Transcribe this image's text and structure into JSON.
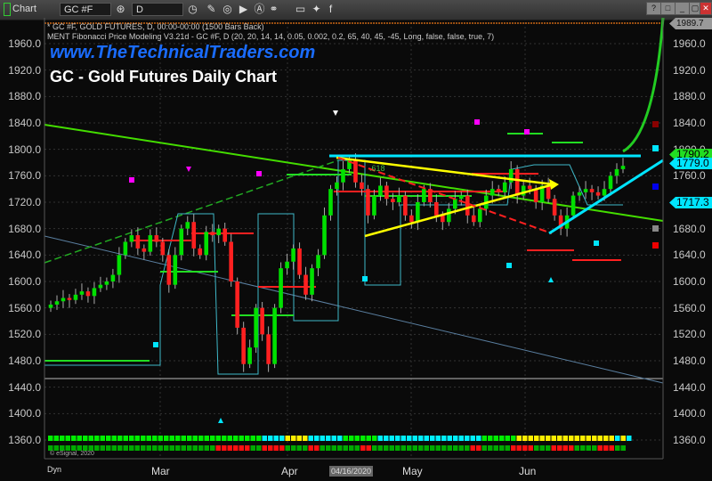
{
  "toolbar": {
    "app_label": "Chart",
    "symbol": "GC #F",
    "interval": "D",
    "window_buttons": [
      "?",
      "□",
      "_",
      "▢",
      "✕"
    ]
  },
  "header": {
    "line1": "* GC #F, GOLD FUTURES, D, 00:00-00:00 (1500 Bars Back)",
    "line2": "MENT Fibonacci Price Modeling V3.21d - GC #F, D (20, 20, 14, 14, 0.05, 0.002, 0.2, 65, 40, 45, -45, Long, false, false, true, 7)"
  },
  "brand": "www.TheTechnicalTraders.com",
  "copyright": "© eSignal, 2020",
  "dyn_label": "Dyn",
  "price_labels": {
    "top": "1989.7",
    "last": "1790.2",
    "level1": "1779.0",
    "level2": "1717.3"
  },
  "colors": {
    "up": "#00e000",
    "down": "#ff2020",
    "cyan": "#00e5ff",
    "yellow": "#ffff00",
    "lime": "#7cfc00",
    "magenta": "#ff00ff"
  },
  "annotation": ".618",
  "chart_data": {
    "type": "candlestick",
    "title": "GC - Gold Futures Daily Chart",
    "ylim": [
      1340,
      1990
    ],
    "yticks": [
      1360,
      1400,
      1440,
      1480,
      1520,
      1560,
      1600,
      1640,
      1680,
      1720,
      1760,
      1800,
      1840,
      1880,
      1920,
      1960
    ],
    "xticks": [
      "Mar",
      "Apr",
      "May",
      "Jun"
    ],
    "crosshair_date": "04/16/2020",
    "closes": [
      1565,
      1570,
      1575,
      1572,
      1580,
      1585,
      1578,
      1590,
      1595,
      1600,
      1610,
      1640,
      1660,
      1670,
      1650,
      1645,
      1670,
      1660,
      1640,
      1595,
      1640,
      1680,
      1690,
      1650,
      1640,
      1675,
      1670,
      1680,
      1660,
      1600,
      1530,
      1475,
      1500,
      1560,
      1520,
      1475,
      1560,
      1620,
      1630,
      1650,
      1610,
      1580,
      1620,
      1640,
      1700,
      1740,
      1750,
      1770,
      1785,
      1750,
      1740,
      1700,
      1730,
      1745,
      1725,
      1720,
      1730,
      1700,
      1690,
      1720,
      1740,
      1720,
      1700,
      1690,
      1710,
      1725,
      1730,
      1700,
      1690,
      1710,
      1730,
      1740,
      1735,
      1750,
      1770,
      1730,
      1745,
      1740,
      1720,
      1745,
      1725,
      1700,
      1680,
      1700,
      1730,
      1735,
      1740,
      1735,
      1730,
      1740,
      1760,
      1770,
      1775
    ],
    "signal_row1": [
      [
        "green",
        37
      ],
      [
        "cyan",
        4
      ],
      [
        "yellow",
        4
      ],
      [
        "cyan",
        6
      ],
      [
        "green",
        6
      ],
      [
        "cyan",
        18
      ],
      [
        "green",
        6
      ],
      [
        "yellow",
        17
      ],
      [
        "cyan",
        1
      ],
      [
        "yellow",
        1
      ],
      [
        "cyan",
        1
      ]
    ],
    "signal_row2": [
      [
        "green",
        29
      ],
      [
        "red",
        6
      ],
      [
        "green",
        2
      ],
      [
        "red",
        4
      ],
      [
        "green",
        4
      ],
      [
        "red",
        2
      ],
      [
        "green",
        7
      ],
      [
        "red",
        2
      ],
      [
        "green",
        17
      ],
      [
        "red",
        2
      ],
      [
        "green",
        5
      ],
      [
        "red",
        4
      ],
      [
        "green",
        3
      ],
      [
        "red",
        4
      ],
      [
        "green",
        4
      ],
      [
        "red",
        3
      ],
      [
        "green",
        2
      ]
    ]
  }
}
